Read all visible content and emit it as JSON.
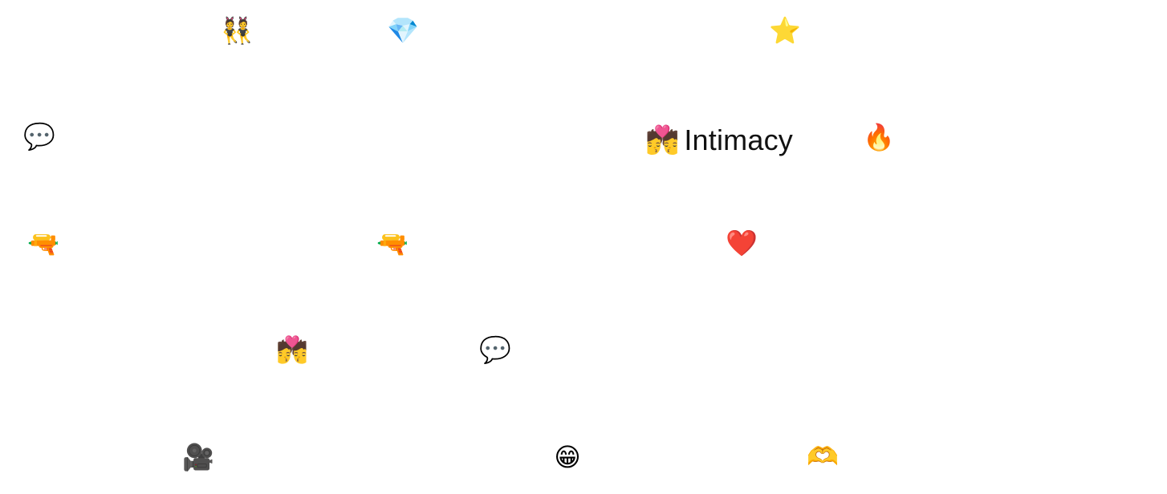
{
  "title": {
    "emoji": "💏",
    "text": "Intimacy"
  },
  "emojis": [
    {
      "name": "dancers-icon",
      "char": "👯"
    },
    {
      "name": "gem-icon",
      "char": "💎"
    },
    {
      "name": "star-icon",
      "char": "⭐"
    },
    {
      "name": "speech-bubble-icon",
      "char": "💬"
    },
    {
      "name": "fire-icon",
      "char": "🔥"
    },
    {
      "name": "water-pistol-icon",
      "char": "🔫"
    },
    {
      "name": "water-pistol-icon",
      "char": "🔫"
    },
    {
      "name": "red-heart-icon",
      "char": "❤️"
    },
    {
      "name": "kiss-icon",
      "char": "💏"
    },
    {
      "name": "speech-bubble-icon",
      "char": "💬"
    },
    {
      "name": "movie-camera-icon",
      "char": "🎥"
    },
    {
      "name": "grinning-face-icon",
      "char": "😁"
    },
    {
      "name": "heart-hands-icon",
      "char": "🫶"
    }
  ]
}
